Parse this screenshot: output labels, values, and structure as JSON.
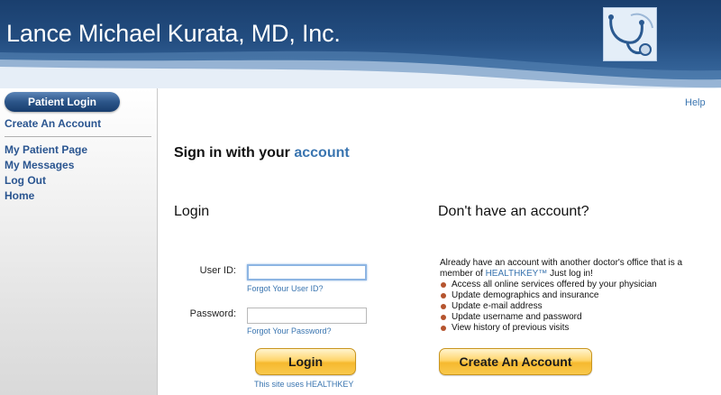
{
  "header": {
    "title": "Lance Michael Kurata, MD, Inc.",
    "logo_icon": "stethoscope-icon"
  },
  "sidebar": {
    "active_label": "Patient Login",
    "create_account": "Create An Account",
    "items": [
      {
        "label": "My Patient Page"
      },
      {
        "label": "My Messages"
      },
      {
        "label": "Log Out"
      },
      {
        "label": "Home"
      }
    ]
  },
  "main": {
    "help": "Help",
    "signin_prefix": "Sign in with your",
    "signin_accent": "account",
    "login": {
      "heading": "Login",
      "user_id_label": "User ID:",
      "user_id_value": "",
      "forgot_user_id": "Forgot Your User ID?",
      "password_label": "Password:",
      "password_value": "",
      "forgot_password": "Forgot Your Password?",
      "button": "Login",
      "uses_prefix": "This site uses",
      "uses_brand": "HEALTHKEY"
    },
    "signup": {
      "heading": "Don't have an account?",
      "intro_line1": "Already have an account with another doctor's office that is a",
      "intro_prefix": "member of",
      "intro_brand": "HEALTHKEY™",
      "intro_suffix": "Just log in!",
      "bullets": [
        "Access all online services offered by your physician",
        "Update demographics and insurance",
        "Update e-mail address",
        "Update username and password",
        "View history of previous visits"
      ],
      "button": "Create An Account"
    }
  },
  "colors": {
    "header_blue": "#234d80",
    "link_blue": "#3a75b0",
    "button_gold": "#f6b92f",
    "bullet_red": "#b5542e"
  }
}
